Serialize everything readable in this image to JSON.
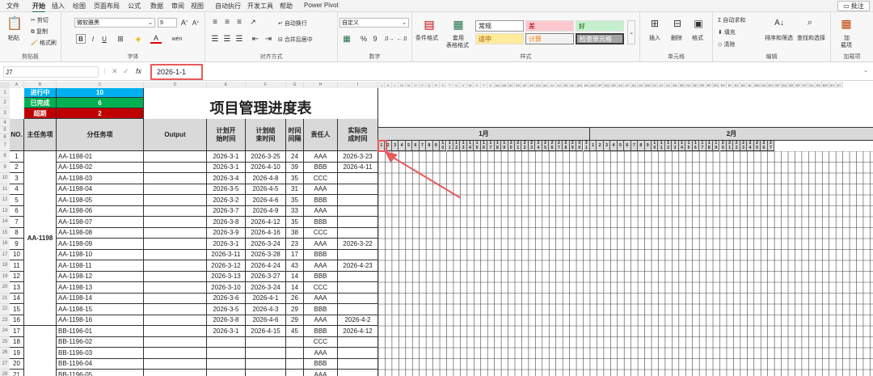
{
  "menu": {
    "items": [
      "文件",
      "开始",
      "插入",
      "绘图",
      "页面布局",
      "公式",
      "数据",
      "审阅",
      "视图",
      "自动执行",
      "开发工具",
      "帮助",
      "Power Pivot"
    ],
    "active": "开始",
    "comment_label": "批注"
  },
  "ribbon": {
    "clipboard": {
      "paste": "粘贴",
      "cut": "剪切",
      "copy": "复制",
      "format_painter": "格式刷",
      "label": "剪贴板"
    },
    "font": {
      "name": "微软雅黑",
      "size": "9",
      "bold": "B",
      "italic": "I",
      "underline": "U",
      "grow": "A^",
      "shrink": "A˅",
      "wen": "wén",
      "label": "字体"
    },
    "alignment": {
      "wrap": "自动换行",
      "merge": "合并后居中",
      "label": "对齐方式"
    },
    "number": {
      "format": "自定义",
      "percent": "%",
      "comma": "9",
      "label": "数字"
    },
    "styles": {
      "conditional": "条件格式",
      "table": "套用",
      "table2": "表格格式",
      "normal": "常规",
      "bad": "差",
      "good": "好",
      "neutral": "适中",
      "calc": "计算",
      "check": "检查单元格",
      "label": "样式"
    },
    "cells": {
      "insert": "插入",
      "delete": "删除",
      "format": "格式",
      "label": "单元格"
    },
    "editing": {
      "autosum": "自动求和",
      "fill": "填充",
      "clear": "清除",
      "sort": "排序和筛选",
      "find": "查找和选择",
      "label": "编辑"
    },
    "addins": {
      "add": "加",
      "add2": "载项",
      "label": "加载项"
    }
  },
  "formula_bar": {
    "name_box": "J7",
    "fx": "fx",
    "value": "2026-1-1"
  },
  "status": {
    "in_progress": {
      "label": "进行中",
      "value": "10",
      "color": "#00b0f0"
    },
    "done": {
      "label": "已完成",
      "value": "6",
      "color": "#00b050"
    },
    "overdue": {
      "label": "超期",
      "value": "2",
      "color": "#c00000"
    }
  },
  "title": "项目管理进度表",
  "headers": {
    "no": "NO.",
    "main": "主任务项",
    "sub": "分任务项",
    "output": "Output",
    "start1": "计划开",
    "start2": "始时间",
    "end1": "计划结",
    "end2": "束时间",
    "gap1": "时间",
    "gap2": "间隔",
    "owner": "责任人",
    "actual1": "实际完",
    "actual2": "成时间"
  },
  "months": [
    "1月",
    "2月"
  ],
  "group_label_1": "AA-1198",
  "rows": [
    {
      "no": "1",
      "sub": "AA-1198-01",
      "start": "2026-3-1",
      "end": "2026-3-25",
      "gap": "24",
      "owner": "AAA",
      "actual": "2026-3-23"
    },
    {
      "no": "2",
      "sub": "AA-1198-02",
      "start": "2026-3-1",
      "end": "2026-4-10",
      "gap": "39",
      "owner": "BBB",
      "actual": "2026-4-11"
    },
    {
      "no": "3",
      "sub": "AA-1198-03",
      "start": "2026-3-4",
      "end": "2026-4-8",
      "gap": "35",
      "owner": "CCC",
      "actual": ""
    },
    {
      "no": "4",
      "sub": "AA-1198-04",
      "start": "2026-3-5",
      "end": "2026-4-5",
      "gap": "31",
      "owner": "AAA",
      "actual": ""
    },
    {
      "no": "5",
      "sub": "AA-1198-05",
      "start": "2026-3-2",
      "end": "2026-4-6",
      "gap": "35",
      "owner": "BBB",
      "actual": ""
    },
    {
      "no": "6",
      "sub": "AA-1198-06",
      "start": "2026-3-7",
      "end": "2026-4-9",
      "gap": "33",
      "owner": "AAA",
      "actual": ""
    },
    {
      "no": "7",
      "sub": "AA-1198-07",
      "start": "2026-3-8",
      "end": "2026-4-12",
      "gap": "35",
      "owner": "BBB",
      "actual": ""
    },
    {
      "no": "8",
      "sub": "AA-1198-08",
      "start": "2026-3-9",
      "end": "2026-4-16",
      "gap": "38",
      "owner": "CCC",
      "actual": ""
    },
    {
      "no": "9",
      "sub": "AA-1198-09",
      "start": "2026-3-1",
      "end": "2026-3-24",
      "gap": "23",
      "owner": "AAA",
      "actual": "2026-3-22"
    },
    {
      "no": "10",
      "sub": "AA-1198-10",
      "start": "2026-3-11",
      "end": "2026-3-28",
      "gap": "17",
      "owner": "BBB",
      "actual": ""
    },
    {
      "no": "11",
      "sub": "AA-1198-11",
      "start": "2026-3-12",
      "end": "2026-4-24",
      "gap": "43",
      "owner": "AAA",
      "actual": "2026-4-23"
    },
    {
      "no": "12",
      "sub": "AA-1198-12",
      "start": "2026-3-13",
      "end": "2026-3-27",
      "gap": "14",
      "owner": "BBB",
      "actual": ""
    },
    {
      "no": "13",
      "sub": "AA-1198-13",
      "start": "2026-3-10",
      "end": "2026-3-24",
      "gap": "14",
      "owner": "CCC",
      "actual": ""
    },
    {
      "no": "14",
      "sub": "AA-1198-14",
      "start": "2026-3-6",
      "end": "2026-4-1",
      "gap": "26",
      "owner": "AAA",
      "actual": ""
    },
    {
      "no": "15",
      "sub": "AA-1198-15",
      "start": "2026-3-5",
      "end": "2026-4-3",
      "gap": "29",
      "owner": "BBB",
      "actual": ""
    },
    {
      "no": "16",
      "sub": "AA-1198-16",
      "start": "2026-3-8",
      "end": "2026-4-6",
      "gap": "29",
      "owner": "AAA",
      "actual": "2026-4-2"
    },
    {
      "no": "17",
      "sub": "BB-1196-01",
      "start": "2026-3-1",
      "end": "2026-4-15",
      "gap": "45",
      "owner": "BBB",
      "actual": "2026-4-12"
    },
    {
      "no": "18",
      "sub": "BB-1196-02",
      "start": "",
      "end": "",
      "gap": "",
      "owner": "CCC",
      "actual": ""
    },
    {
      "no": "19",
      "sub": "BB-1196-03",
      "start": "",
      "end": "",
      "gap": "",
      "owner": "AAA",
      "actual": ""
    },
    {
      "no": "20",
      "sub": "BB-1196-04",
      "start": "",
      "end": "",
      "gap": "",
      "owner": "BBB",
      "actual": ""
    },
    {
      "no": "21",
      "sub": "BB-1196-05",
      "start": "",
      "end": "",
      "gap": "",
      "owner": "AAA",
      "actual": ""
    }
  ],
  "row_numbers": [
    "1",
    "2",
    "3",
    "4",
    "5",
    "6",
    "7",
    "8",
    "9",
    "10",
    "11",
    "12",
    "13",
    "14",
    "15",
    "16",
    "17",
    "18",
    "19",
    "20",
    "21",
    "22",
    "23",
    "24",
    "25",
    "26",
    "27",
    "28"
  ],
  "col_letters_left": [
    "A",
    "B",
    "C",
    "D",
    "E",
    "F",
    "G",
    "H",
    "I"
  ],
  "col_letters_right": [
    "J",
    "K",
    "L",
    "M",
    "N",
    "O",
    "P",
    "Q",
    "R",
    "S",
    "T",
    "U",
    "V",
    "W",
    "X",
    "Y",
    "Z",
    "AA",
    "AB",
    "AC",
    "AD",
    "AE",
    "AF",
    "AG",
    "AH",
    "AI",
    "AJ",
    "AK",
    "AL",
    "AM",
    "AN",
    "AO",
    "AP",
    "AQ",
    "AR",
    "AS",
    "AT",
    "AU",
    "AV",
    "AW",
    "AX",
    "AY",
    "AZ",
    "BA",
    "BB",
    "BC",
    "BD",
    "BE",
    "BF",
    "BG",
    "BH",
    "BI",
    "BJ",
    "BK",
    "BL",
    "BM",
    "BN",
    "BO",
    "BP",
    "BQ",
    "BR",
    "BS",
    "BT",
    "BU",
    "BV",
    "BW",
    "BX",
    "BY"
  ],
  "days_jan": [
    "1",
    "2",
    "3",
    "4",
    "5",
    "6",
    "7",
    "8",
    "9",
    "10",
    "11",
    "12",
    "13",
    "14",
    "15",
    "16",
    "17",
    "18",
    "19",
    "20",
    "21",
    "22",
    "23",
    "24",
    "25",
    "26",
    "27",
    "28",
    "29",
    "30",
    "31"
  ],
  "days_feb": [
    "1",
    "2",
    "3",
    "4",
    "5",
    "6",
    "7",
    "8",
    "9",
    "10",
    "11",
    "12",
    "13",
    "14",
    "15",
    "16",
    "17",
    "18",
    "19",
    "20",
    "21",
    "22",
    "23",
    "24",
    "25",
    "26",
    "27"
  ],
  "highlight_color": "#e85a5a"
}
